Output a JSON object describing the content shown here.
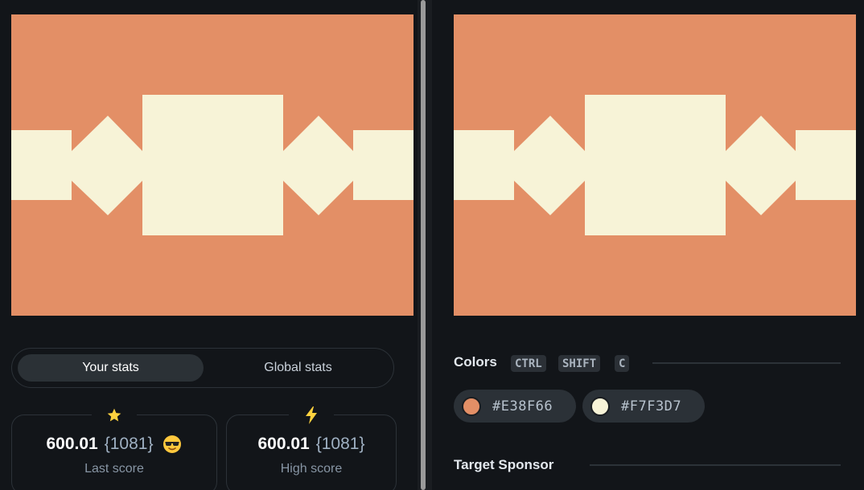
{
  "target": {
    "background": "#E38F66",
    "foreground": "#F7F3D7"
  },
  "stats": {
    "tabs": {
      "your_stats": "Your stats",
      "global_stats": "Global stats"
    },
    "last_score": {
      "icon": "star-icon",
      "value": "600.01",
      "chars": "{1081}",
      "emoji": "sunglasses-emoji",
      "caption": "Last score"
    },
    "high_score": {
      "icon": "lightning-icon",
      "value": "600.01",
      "chars": "{1081}",
      "caption": "High score"
    }
  },
  "colors": {
    "title": "Colors",
    "shortcut": [
      "CTRL",
      "SHIFT",
      "C"
    ],
    "swatches": [
      {
        "hex": "#E38F66"
      },
      {
        "hex": "#F7F3D7"
      }
    ]
  },
  "sponsor": {
    "title": "Target Sponsor"
  }
}
